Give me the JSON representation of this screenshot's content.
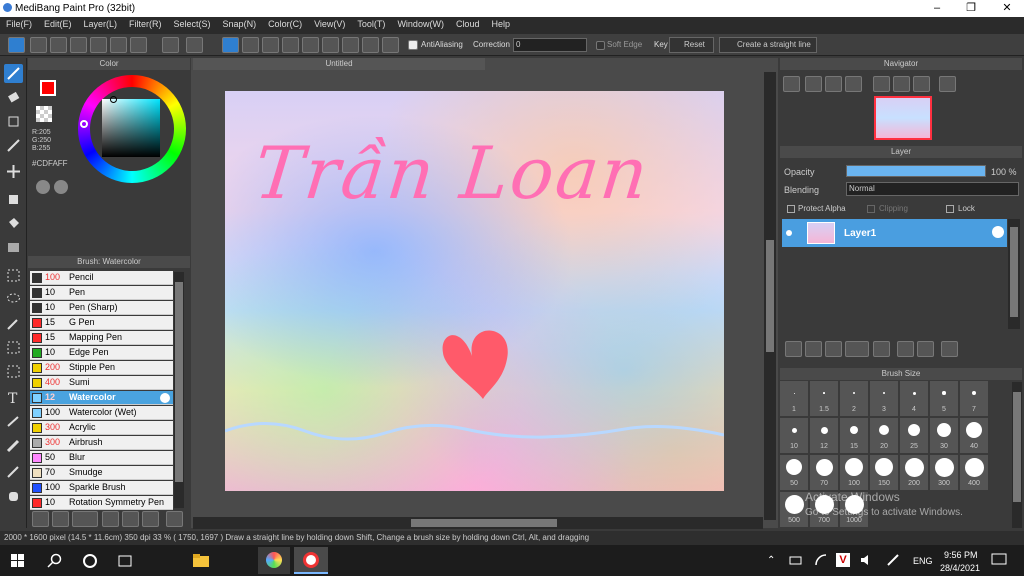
{
  "window": {
    "title": "MediBang Paint Pro (32bit)"
  },
  "menu": [
    "File(F)",
    "Edit(E)",
    "Layer(L)",
    "Filter(R)",
    "Select(S)",
    "Snap(N)",
    "Color(C)",
    "View(V)",
    "Tool(T)",
    "Window(W)",
    "Cloud",
    "Help"
  ],
  "toolbar": {
    "antialiasing": "AntiAliasing",
    "correction_label": "Correction",
    "correction_value": "0",
    "soft_edge": "Soft Edge",
    "key": "Key",
    "reset": "Reset",
    "straight_line": "Create a straight line"
  },
  "color_panel": {
    "title": "Color",
    "r": "R:205",
    "g": "G:250",
    "b": "B:255",
    "hex": "#CDFAFF",
    "fg_color": "#ff0000",
    "bg_color": "#000000"
  },
  "brush_panel": {
    "title": "Brush: Watercolor",
    "items": [
      {
        "size": "100",
        "name": "Pencil",
        "color": "#333333",
        "size_red": true
      },
      {
        "size": "10",
        "name": "Pen",
        "color": "#333333"
      },
      {
        "size": "10",
        "name": "Pen (Sharp)",
        "color": "#333333"
      },
      {
        "size": "15",
        "name": "G Pen",
        "color": "#ff2a2a"
      },
      {
        "size": "15",
        "name": "Mapping Pen",
        "color": "#ff2a2a"
      },
      {
        "size": "10",
        "name": "Edge Pen",
        "color": "#22aa22"
      },
      {
        "size": "200",
        "name": "Stipple Pen",
        "color": "#f0d000",
        "size_red": true
      },
      {
        "size": "400",
        "name": "Sumi",
        "color": "#f0d000",
        "size_red": true
      },
      {
        "size": "12",
        "name": "Watercolor",
        "color": "#7fd0ff",
        "selected": true
      },
      {
        "size": "100",
        "name": "Watercolor (Wet)",
        "color": "#7fd0ff"
      },
      {
        "size": "300",
        "name": "Acrylic",
        "color": "#f0d000",
        "size_red": true
      },
      {
        "size": "300",
        "name": "Airbrush",
        "color": "#aaaaaa",
        "size_red": true
      },
      {
        "size": "50",
        "name": "Blur",
        "color": "#ff88ff"
      },
      {
        "size": "70",
        "name": "Smudge",
        "color": "#f0e0c0"
      },
      {
        "size": "100",
        "name": "Sparkle Brush",
        "color": "#2050ff"
      },
      {
        "size": "10",
        "name": "Rotation Symmetry Pen",
        "color": "#ff2a2a"
      }
    ]
  },
  "canvas": {
    "tab": "Untitled",
    "text": "Trần Loan"
  },
  "navigator": {
    "title": "Navigator"
  },
  "layer_panel": {
    "title": "Layer",
    "opacity_label": "Opacity",
    "opacity_value": "100 %",
    "opacity": 1.0,
    "blending_label": "Blending",
    "blending_value": "Normal",
    "protect_alpha": "Protect Alpha",
    "clipping": "Clipping",
    "lock": "Lock",
    "layer_name": "Layer1"
  },
  "brush_size": {
    "title": "Brush Size",
    "labels": [
      "1",
      "1.5",
      "2",
      "3",
      "4",
      "5",
      "7",
      "10",
      "12",
      "15",
      "20",
      "25",
      "30",
      "40",
      "50",
      "70",
      "100",
      "150",
      "200",
      "300",
      "400",
      "500",
      "700",
      "1000"
    ]
  },
  "status": {
    "text": "2000 * 1600 pixel  (14.5 * 11.6cm)  350 dpi  33 %  ( 1750, 1697 )  Draw a straight line by holding down Shift, Change a brush size by holding down Ctrl, Alt, and dragging"
  },
  "watermark": {
    "line1": "Activate Windows",
    "line2": "Go to Settings to activate Windows."
  },
  "taskbar": {
    "lang": "ENG",
    "time": "9:56 PM",
    "date": "28/4/2021"
  }
}
